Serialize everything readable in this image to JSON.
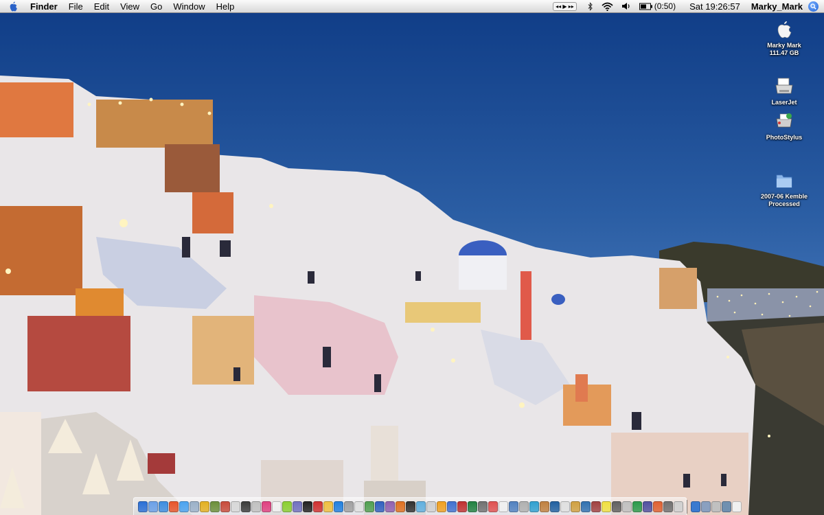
{
  "menubar": {
    "app_name": "Finder",
    "menus": [
      "File",
      "Edit",
      "View",
      "Go",
      "Window",
      "Help"
    ],
    "media_control_symbols": "◂◂ ▶ ▸▸",
    "battery_time": "(0:50)",
    "clock": "Sat 19:26:57",
    "user": "Marky_Mark",
    "icons": [
      "apple-icon",
      "bluetooth-icon",
      "wifi-icon",
      "volume-icon",
      "battery-icon",
      "spotlight-icon"
    ]
  },
  "desktop": {
    "icons": [
      {
        "name": "Marky Mark",
        "detail": "111.47 GB",
        "icon": "apple-drive-icon"
      },
      {
        "name": "LaserJet",
        "icon": "printer-icon"
      },
      {
        "name": "PhotoStylus",
        "icon": "inkjet-printer-icon"
      },
      {
        "name": "2007-06 Kemble Processed",
        "line1": "2007-06 Kemble",
        "line2": "Processed",
        "icon": "folder-icon"
      }
    ]
  },
  "dock": {
    "app_colors": [
      "#2a6fd6",
      "#6aa0e8",
      "#3c8de0",
      "#e8552a",
      "#4aa3f0",
      "#9ab0c8",
      "#e4b020",
      "#6b8f3a",
      "#c84a3a",
      "#d8d8d8",
      "#3a3a3a",
      "#c0c0c0",
      "#e04080",
      "#f2f2f2",
      "#8ad030",
      "#7070c0",
      "#202020",
      "#d03030",
      "#f0c040",
      "#2080e0",
      "#a0a0a0",
      "#e0e0e0",
      "#50a050",
      "#3060c0",
      "#9060b0",
      "#e07020",
      "#303030",
      "#60b0e0",
      "#d0d0d0",
      "#f0a020",
      "#4070d0",
      "#c03030",
      "#208040",
      "#707070",
      "#e05050",
      "#f0f0f0",
      "#5080c0",
      "#b0b0b0",
      "#30a0d0",
      "#c08040",
      "#2060a0",
      "#e0e0e0",
      "#d0a040",
      "#3070b0",
      "#a04040",
      "#f0e040",
      "#606060",
      "#c0c0c0",
      "#2a9a4a",
      "#5050a0",
      "#e06030",
      "#707070",
      "#d0d0d0"
    ],
    "right_colors": [
      "#3a7ad0",
      "#8aa0c0",
      "#c0c0c0",
      "#7090b0",
      "#f0f0f0"
    ]
  }
}
